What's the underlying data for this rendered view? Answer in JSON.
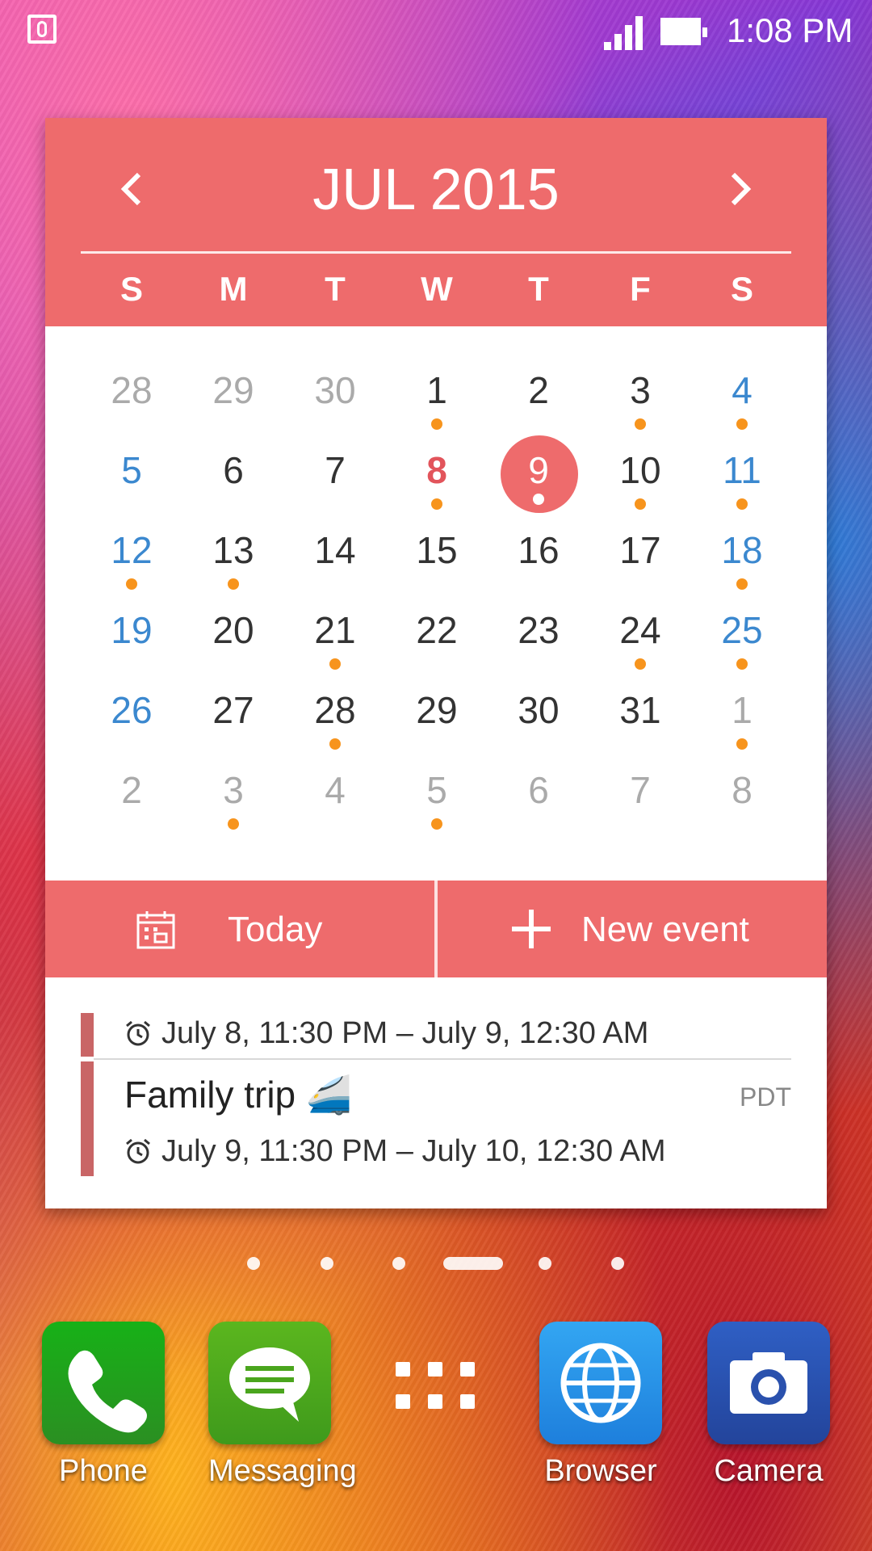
{
  "status_bar": {
    "time": "1:08 PM"
  },
  "calendar": {
    "month_title": "JUL 2015",
    "weekdays": [
      "S",
      "M",
      "T",
      "W",
      "T",
      "F",
      "S"
    ],
    "weeks": [
      [
        {
          "d": "28",
          "muted": true
        },
        {
          "d": "29",
          "muted": true
        },
        {
          "d": "30",
          "muted": true
        },
        {
          "d": "1",
          "dot": true
        },
        {
          "d": "2"
        },
        {
          "d": "3",
          "dot": true
        },
        {
          "d": "4",
          "weekend": true,
          "dot": true
        }
      ],
      [
        {
          "d": "5",
          "weekend": true
        },
        {
          "d": "6"
        },
        {
          "d": "7"
        },
        {
          "d": "8",
          "red": true,
          "dot": true
        },
        {
          "d": "9",
          "selected": true,
          "dot": true
        },
        {
          "d": "10",
          "dot": true
        },
        {
          "d": "11",
          "weekend": true,
          "dot": true
        }
      ],
      [
        {
          "d": "12",
          "weekend": true,
          "dot": true
        },
        {
          "d": "13",
          "dot": true
        },
        {
          "d": "14"
        },
        {
          "d": "15"
        },
        {
          "d": "16"
        },
        {
          "d": "17"
        },
        {
          "d": "18",
          "weekend": true,
          "dot": true
        }
      ],
      [
        {
          "d": "19",
          "weekend": true
        },
        {
          "d": "20"
        },
        {
          "d": "21",
          "dot": true
        },
        {
          "d": "22"
        },
        {
          "d": "23"
        },
        {
          "d": "24",
          "dot": true
        },
        {
          "d": "25",
          "weekend": true,
          "dot": true
        }
      ],
      [
        {
          "d": "26",
          "weekend": true
        },
        {
          "d": "27"
        },
        {
          "d": "28",
          "dot": true
        },
        {
          "d": "29"
        },
        {
          "d": "30"
        },
        {
          "d": "31"
        },
        {
          "d": "1",
          "muted": true,
          "dot": true
        }
      ],
      [
        {
          "d": "2",
          "muted": true
        },
        {
          "d": "3",
          "muted": true,
          "dot": true
        },
        {
          "d": "4",
          "muted": true
        },
        {
          "d": "5",
          "muted": true,
          "dot": true
        },
        {
          "d": "6",
          "muted": true
        },
        {
          "d": "7",
          "muted": true
        },
        {
          "d": "8",
          "muted": true
        }
      ]
    ],
    "today_label": "Today",
    "new_event_label": "New event"
  },
  "events": [
    {
      "title": "",
      "time": "July 8, 11:30 PM – July 9, 12:30 AM",
      "tz": ""
    },
    {
      "title": "Family trip 🚄",
      "time": "July 9, 11:30 PM – July 10, 12:30 AM",
      "tz": "PDT"
    }
  ],
  "dock": [
    {
      "label": "Phone",
      "icon": "phone-icon",
      "color": "#2aa52a"
    },
    {
      "label": "Messaging",
      "icon": "messaging-icon",
      "color": "#5cb025"
    },
    {
      "label": "",
      "icon": "app-drawer-icon",
      "color": ""
    },
    {
      "label": "Browser",
      "icon": "globe-icon",
      "color": "#2a8ee8"
    },
    {
      "label": "Camera",
      "icon": "camera-icon",
      "color": "#2b57b7"
    }
  ],
  "colors": {
    "accent": "#ee6b6c",
    "weekend": "#3b88cf",
    "event_dot": "#f7941d"
  }
}
